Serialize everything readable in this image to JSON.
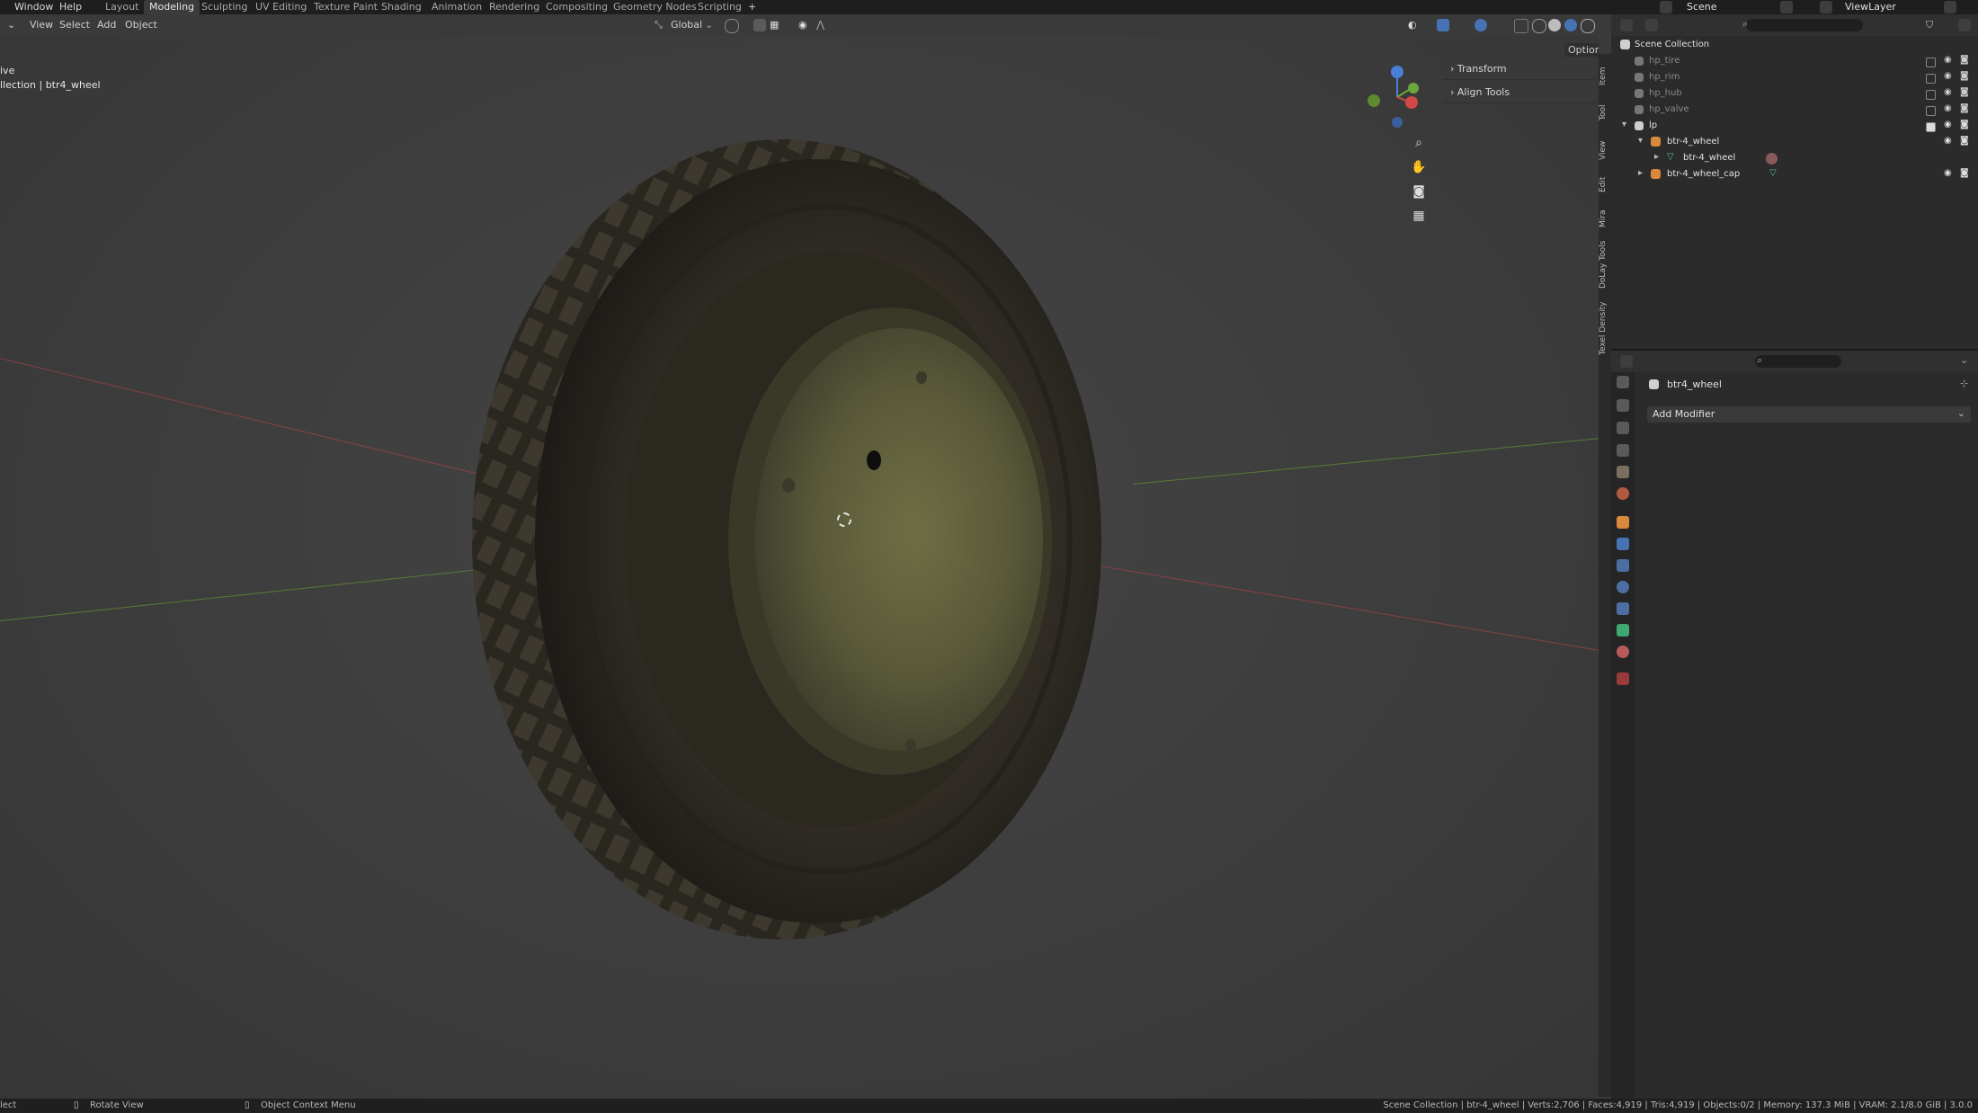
{
  "topbar": {
    "menus": [
      "Window",
      "Help"
    ],
    "workspace_tabs": [
      "Layout",
      "Modeling",
      "Sculpting",
      "UV Editing",
      "Texture Paint",
      "Shading",
      "Animation",
      "Rendering",
      "Compositing",
      "Geometry Nodes",
      "Scripting"
    ],
    "active_tab": "Modeling",
    "add_tab": "+",
    "scene_label": "Scene",
    "viewlayer_label": "ViewLayer"
  },
  "viewport_header": {
    "menus": [
      "View",
      "Select",
      "Add",
      "Object"
    ],
    "transform_orientation": "Global",
    "options_label": "Options"
  },
  "viewport": {
    "mode_text": "ive",
    "collection_text": "llection | btr4_wheel"
  },
  "npanel": {
    "panels": [
      "Transform",
      "Align Tools"
    ],
    "tabs": [
      "Item",
      "Tool",
      "View",
      "Edit",
      "Mira",
      "DoLay Tools",
      "Texel Density"
    ]
  },
  "outliner": {
    "root": "Scene Collection",
    "rows": [
      {
        "label": "hp_tire",
        "dim": true
      },
      {
        "label": "hp_rim",
        "dim": true
      },
      {
        "label": "hp_hub",
        "dim": true
      },
      {
        "label": "hp_valve",
        "dim": true
      },
      {
        "label": "lp",
        "dim": false
      },
      {
        "label": "btr-4_wheel",
        "dim": false
      },
      {
        "label": "btr-4_wheel",
        "dim": false
      },
      {
        "label": "btr-4_wheel_cap",
        "dim": false
      }
    ]
  },
  "properties": {
    "object_name": "btr4_wheel",
    "add_modifier_label": "Add Modifier"
  },
  "statusbar": {
    "left_text": "lect",
    "rotate_label": "Rotate View",
    "context_label": "Object Context Menu",
    "stats": "Scene Collection | btr-4_wheel | Verts:2,706 | Faces:4,919 | Tris:4,919 | Objects:0/2 | Memory: 137.3 MiB | VRAM: 2.1/8.0 GiB | 3.0.0"
  },
  "colors": {
    "axis_x": "#b84a4a",
    "axis_y": "#6a9a3a",
    "accent": "#4772b3"
  }
}
